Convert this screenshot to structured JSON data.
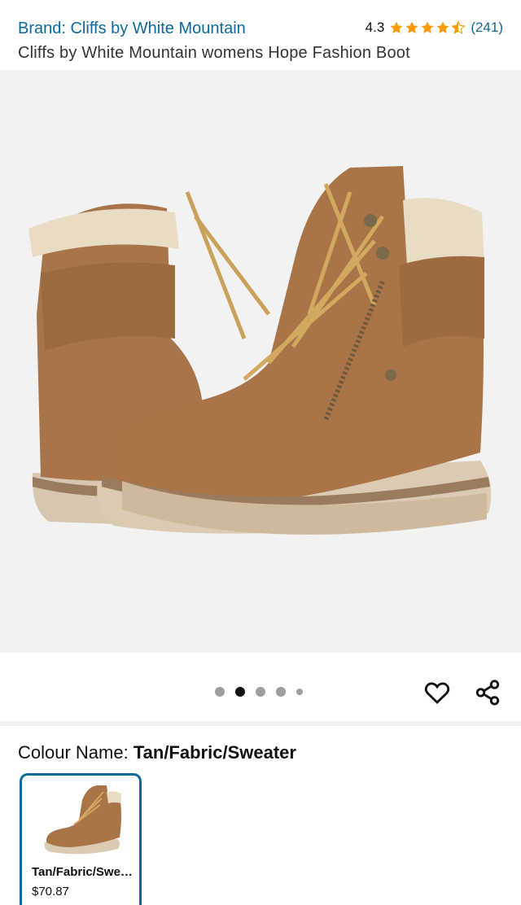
{
  "header": {
    "brand": "Brand: Cliffs by White Mountain",
    "rating_value": "4.3",
    "rating_stars": 4.3,
    "rating_count": "(241)",
    "title": "Cliffs by White Mountain womens Hope Fashion Boot"
  },
  "gallery": {
    "image": "tan-lace-up-boots-with-knit-cuff",
    "dots_total": 5,
    "active_dot": 2
  },
  "actions": {
    "wishlist_icon": "heart-icon",
    "share_icon": "share-icon"
  },
  "colour": {
    "label": "Colour Name: ",
    "value": "Tan/Fabric/Sweater"
  },
  "swatches": [
    {
      "name": "Tan/Fabric/Sweater",
      "price": "$70.87",
      "selected": true
    }
  ],
  "colors": {
    "link": "#0b6a9b",
    "star": "#ff9900",
    "selected_border": "#0b6a9b"
  }
}
